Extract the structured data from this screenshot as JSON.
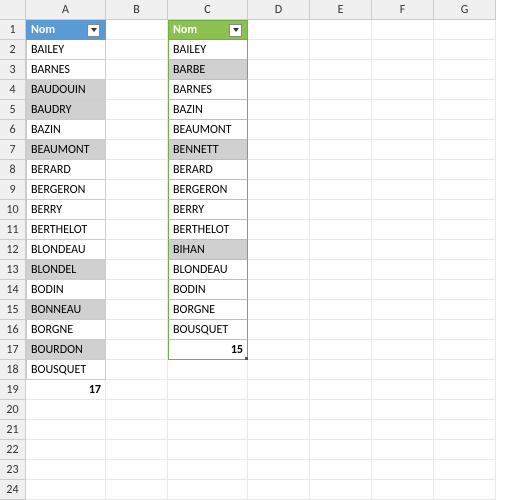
{
  "columns": [
    "A",
    "B",
    "C",
    "D",
    "E",
    "F",
    "G"
  ],
  "row_count": 24,
  "colA": {
    "header": "Nom",
    "values": [
      "BAILEY",
      "BARNES",
      "BAUDOUIN",
      "BAUDRY",
      "BAZIN",
      "BEAUMONT",
      "BERARD",
      "BERGERON",
      "BERRY",
      "BERTHELOT",
      "BLONDEAU",
      "BLONDEL",
      "BODIN",
      "BONNEAU",
      "BORGNE",
      "BOURDON",
      "BOUSQUET"
    ],
    "highlighted_rows": [
      4,
      5,
      7,
      13,
      15,
      17
    ],
    "total": "17",
    "total_row": 19
  },
  "colC": {
    "header": "Nom",
    "values": [
      "BAILEY",
      "BARBE",
      "BARNES",
      "BAZIN",
      "BEAUMONT",
      "BENNETT",
      "BERARD",
      "BERGERON",
      "BERRY",
      "BERTHELOT",
      "BIHAN",
      "BLONDEAU",
      "BODIN",
      "BORGNE",
      "BOUSQUET"
    ],
    "highlighted_rows": [
      3,
      7,
      12
    ],
    "total": "15",
    "total_row": 17
  }
}
